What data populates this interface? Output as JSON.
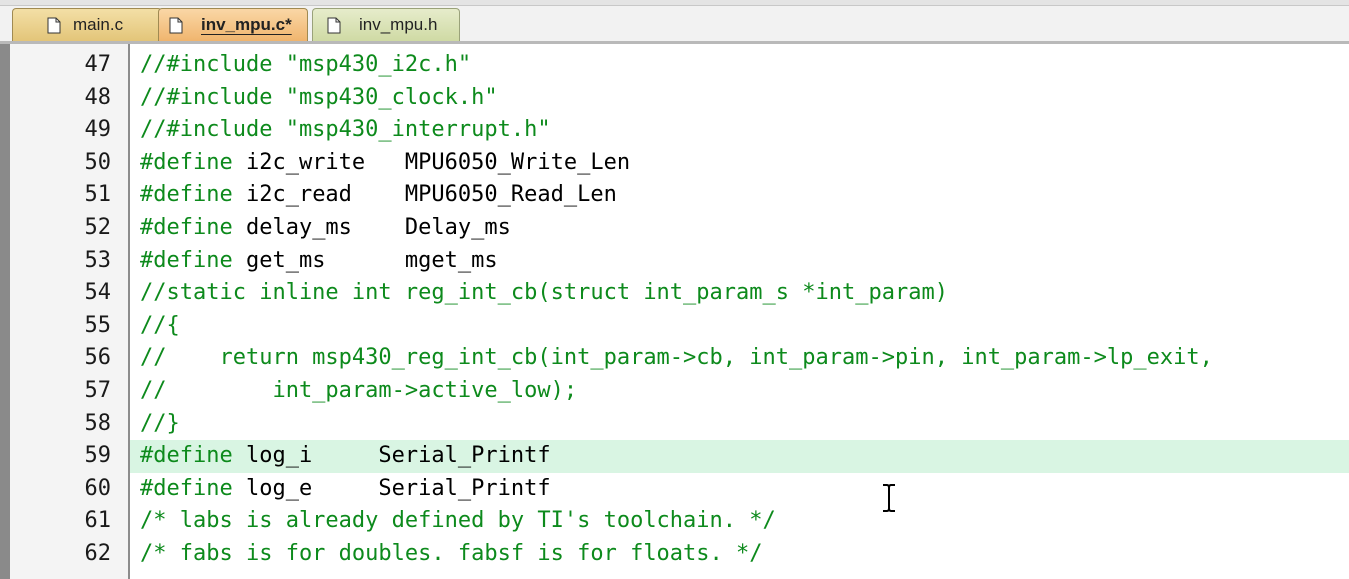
{
  "tabs": [
    {
      "label": "main.c",
      "active": false,
      "color": "#e3c579"
    },
    {
      "label": "inv_mpu.c*",
      "active": true,
      "color": "#f0b56e"
    },
    {
      "label": "inv_mpu.h",
      "active": false,
      "color": "#cfdaa4"
    }
  ],
  "editor": {
    "highlight_color": "#d9f5e3",
    "comment_color": "#0d8a1c",
    "lines": [
      {
        "num": "47",
        "parts": [
          {
            "t": "//#include \"msp430_i2c.h\"",
            "k": "comment"
          }
        ]
      },
      {
        "num": "48",
        "parts": [
          {
            "t": "//#include \"msp430_clock.h\"",
            "k": "comment"
          }
        ]
      },
      {
        "num": "49",
        "parts": [
          {
            "t": "//#include \"msp430_interrupt.h\"",
            "k": "comment"
          }
        ]
      },
      {
        "num": "50",
        "parts": [
          {
            "t": "#define",
            "k": "pre"
          },
          {
            "t": " i2c_write   MPU6050_Write_Len",
            "k": "text"
          }
        ]
      },
      {
        "num": "51",
        "parts": [
          {
            "t": "#define",
            "k": "pre"
          },
          {
            "t": " i2c_read    MPU6050_Read_Len",
            "k": "text"
          }
        ]
      },
      {
        "num": "52",
        "parts": [
          {
            "t": "#define",
            "k": "pre"
          },
          {
            "t": " delay_ms    Delay_ms",
            "k": "text"
          }
        ]
      },
      {
        "num": "53",
        "parts": [
          {
            "t": "#define",
            "k": "pre"
          },
          {
            "t": " get_ms      mget_ms",
            "k": "text"
          }
        ]
      },
      {
        "num": "54",
        "parts": [
          {
            "t": "//static inline int reg_int_cb(struct int_param_s *int_param)",
            "k": "comment"
          }
        ]
      },
      {
        "num": "55",
        "parts": [
          {
            "t": "//{",
            "k": "comment"
          }
        ]
      },
      {
        "num": "56",
        "parts": [
          {
            "t": "//    return msp430_reg_int_cb(int_param->cb, int_param->pin, int_param->lp_exit,",
            "k": "comment"
          }
        ]
      },
      {
        "num": "57",
        "parts": [
          {
            "t": "//        int_param->active_low);",
            "k": "comment"
          }
        ]
      },
      {
        "num": "58",
        "parts": [
          {
            "t": "//}",
            "k": "comment"
          }
        ]
      },
      {
        "num": "59",
        "highlight": true,
        "parts": [
          {
            "t": "#define",
            "k": "pre"
          },
          {
            "t": " log_i     Serial_Printf",
            "k": "text"
          }
        ]
      },
      {
        "num": "60",
        "parts": [
          {
            "t": "#define",
            "k": "pre"
          },
          {
            "t": " log_e     Serial_Printf",
            "k": "text"
          }
        ]
      },
      {
        "num": "61",
        "parts": [
          {
            "t": "/* labs is already defined by TI's toolchain. */",
            "k": "comment"
          }
        ]
      },
      {
        "num": "62",
        "parts": [
          {
            "t": "/* fabs is for doubles. fabsf is for floats. */",
            "k": "comment"
          }
        ]
      }
    ]
  },
  "icons": {
    "tab_icon": "document-icon",
    "cursor": "text-cursor-icon"
  }
}
